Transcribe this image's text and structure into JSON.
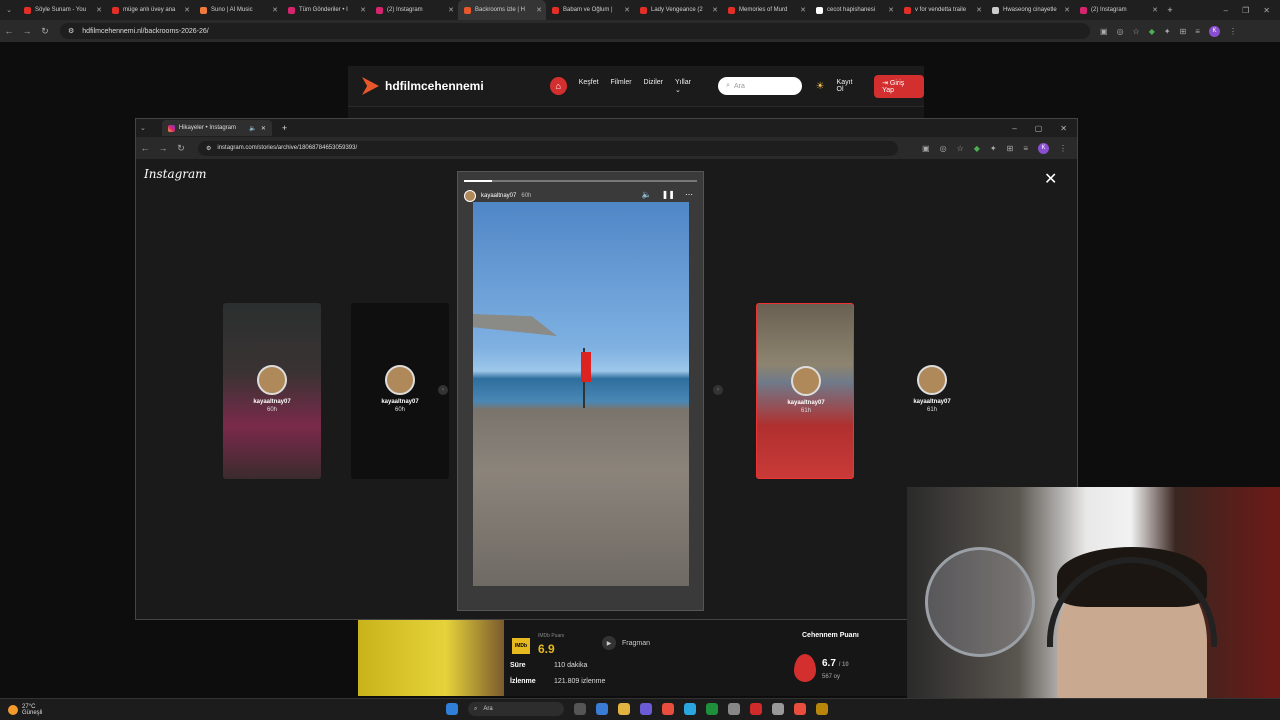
{
  "browser": {
    "tabs": [
      {
        "label": "Söyle Sunam - You",
        "color": "#e52d27"
      },
      {
        "label": "müge anlı üvey ana",
        "color": "#e52d27"
      },
      {
        "label": "Suno | AI Music",
        "color": "#f07a3c"
      },
      {
        "label": "Tüm Gönderiler • I",
        "color": "#d6246e"
      },
      {
        "label": "(2) Instagram",
        "color": "#d6246e"
      },
      {
        "label": "Backrooms izle | H",
        "color": "#e8572a",
        "active": true
      },
      {
        "label": "Babam ve Oğlum |",
        "color": "#e52d27"
      },
      {
        "label": "Lady Vengeance (2",
        "color": "#e52d27"
      },
      {
        "label": "Memories of Murd",
        "color": "#e52d27"
      },
      {
        "label": "cecot hapishanesi",
        "color": "#ffffff"
      },
      {
        "label": "v for vendetta traile",
        "color": "#e52d27"
      },
      {
        "label": "Hwaseong cinayetle",
        "color": "#cccccc"
      },
      {
        "label": "(2) Instagram",
        "color": "#d6246e"
      }
    ],
    "url": "hdfilmcehennemi.nl/backrooms-2026-26/",
    "profile_initial": "K"
  },
  "site": {
    "brand": "hdfilmcehennemi",
    "nav": [
      "Keşfet",
      "Filmler",
      "Diziler",
      "Yıllar"
    ],
    "search_placeholder": "Ara",
    "register": "Kayıt Ol",
    "login": "Giriş Yap"
  },
  "popup": {
    "tab_title": "Hikayeler • Instagram",
    "url": "instagram.com/stories/archive/18068784653059393/",
    "profile_initial": "K"
  },
  "instagram": {
    "logo": "Instagram",
    "main_story": {
      "username": "kayaaltnay07",
      "time": "60h",
      "progress": 0.12
    },
    "side_stories": [
      {
        "username": "kayaaltnay07",
        "time": "60h"
      },
      {
        "username": "kayaaltnay07",
        "time": "60h"
      },
      {
        "username": "kayaaltnay07",
        "time": "61h"
      },
      {
        "username": "kayaaltnay07",
        "time": "61h"
      }
    ]
  },
  "movie": {
    "imdb_badge": "IMDb",
    "imdb_label": "IMDb Puanı",
    "imdb_rating": "6.9",
    "trailer": "Fragman",
    "duration_label": "Süre",
    "duration_value": "110 dakika",
    "views_label": "İzlenme",
    "views_value": "121.809 izlenme",
    "hell_label": "Cehennem Puanı",
    "hell_score": "6.7",
    "hell_max": "/ 10",
    "hell_votes": "567 oy"
  },
  "taskbar": {
    "temp": "27°C",
    "condition": "Güneşli",
    "search": "Ara"
  }
}
